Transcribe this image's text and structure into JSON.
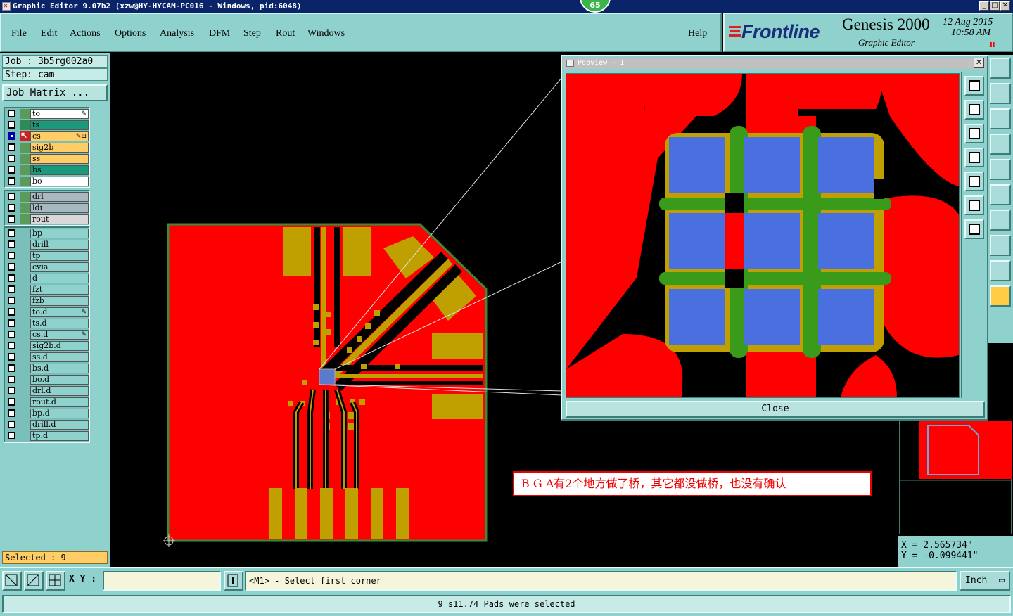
{
  "window": {
    "title": "Graphic Editor 9.07b2 (xzw@HY-HYCAM-PC016 - Windows, pid:6048)",
    "badge": "65",
    "minimize": "_",
    "maximize": "□",
    "close": "✕"
  },
  "menu": [
    "File",
    "Edit",
    "Actions",
    "Options",
    "Analysis",
    "DFM",
    "Step",
    "Rout",
    "Windows"
  ],
  "help": "Help",
  "logo": {
    "brand": "Frontline",
    "product": "Genesis 2000",
    "subtitle": "Graphic Editor",
    "date": "12 Aug 2015",
    "time": "10:58 AM",
    "pause": "II"
  },
  "job": {
    "job_label": "Job : 3b5rg002a0",
    "step_label": "Step: cam",
    "matrix_button": "Job Matrix ..."
  },
  "layers": {
    "board": [
      {
        "name": "to",
        "color": "#ffffff",
        "swatch": "#5a9a5a",
        "mark": "✎",
        "selected": false
      },
      {
        "name": "ts",
        "color": "#1a9a7a",
        "swatch": "#2e8b57",
        "mark": "",
        "selected": false
      },
      {
        "name": "cs",
        "color": "#ffcc66",
        "swatch": "#cc2222",
        "mark": "✎⊞",
        "selected": true
      },
      {
        "name": "sig2b",
        "color": "#ffcc66",
        "swatch": "#5a9a5a",
        "mark": "",
        "selected": false
      },
      {
        "name": "ss",
        "color": "#ffcc66",
        "swatch": "#5a9a5a",
        "mark": "",
        "selected": false
      },
      {
        "name": "bs",
        "color": "#1a9a7a",
        "swatch": "#5a9a5a",
        "mark": "",
        "selected": false
      },
      {
        "name": "bo",
        "color": "#ffffff",
        "swatch": "#5a9a5a",
        "mark": "",
        "selected": false
      }
    ],
    "drill": [
      {
        "name": "drl",
        "color": "#a8b8c0",
        "swatch": "#5a9a5a",
        "mark": ""
      },
      {
        "name": "ldi",
        "color": "#a8b8c0",
        "swatch": "#5a9a5a",
        "mark": ""
      },
      {
        "name": "rout",
        "color": "#d8d8d8",
        "swatch": "#5a9a5a",
        "mark": ""
      }
    ],
    "misc": [
      {
        "name": "bp",
        "mark": ""
      },
      {
        "name": "drill",
        "mark": ""
      },
      {
        "name": "tp",
        "mark": ""
      },
      {
        "name": "cvia",
        "mark": ""
      },
      {
        "name": "d",
        "mark": ""
      },
      {
        "name": "fzt",
        "mark": ""
      },
      {
        "name": "fzb",
        "mark": ""
      },
      {
        "name": "to.d",
        "mark": "✎"
      },
      {
        "name": "ts.d",
        "mark": ""
      },
      {
        "name": "cs.d",
        "mark": "✎"
      },
      {
        "name": "sig2b.d",
        "mark": ""
      },
      {
        "name": "ss.d",
        "mark": ""
      },
      {
        "name": "bs.d",
        "mark": ""
      },
      {
        "name": "bo.d",
        "mark": ""
      },
      {
        "name": "drl.d",
        "mark": ""
      },
      {
        "name": "rout.d",
        "mark": ""
      },
      {
        "name": "bp.d",
        "mark": ""
      },
      {
        "name": "drill.d",
        "mark": ""
      },
      {
        "name": "tp.d",
        "mark": ""
      }
    ]
  },
  "selected_label": "Selected : 9",
  "popview": {
    "title": "Popview - 1",
    "close_x": "✕",
    "close_button": "Close"
  },
  "annotation": "B G A有2个地方做了桥，其它都没做桥，也没有确认",
  "coords": {
    "x": "X = 2.565734\"",
    "y": "Y = -0.099441\""
  },
  "bottom": {
    "xy_label": "X Y :",
    "xy_value": "",
    "prompt": "<M1> - Select first corner",
    "unit": "Inch",
    "unit_icon": "▭",
    "status": "9 s11.74 Pads were selected"
  },
  "colors": {
    "copper": "#ff0000",
    "pad": "#c0a000",
    "mask": "#3a9a1a",
    "bga_pad": "#4a70e0",
    "panel": "#8fd1cc"
  }
}
